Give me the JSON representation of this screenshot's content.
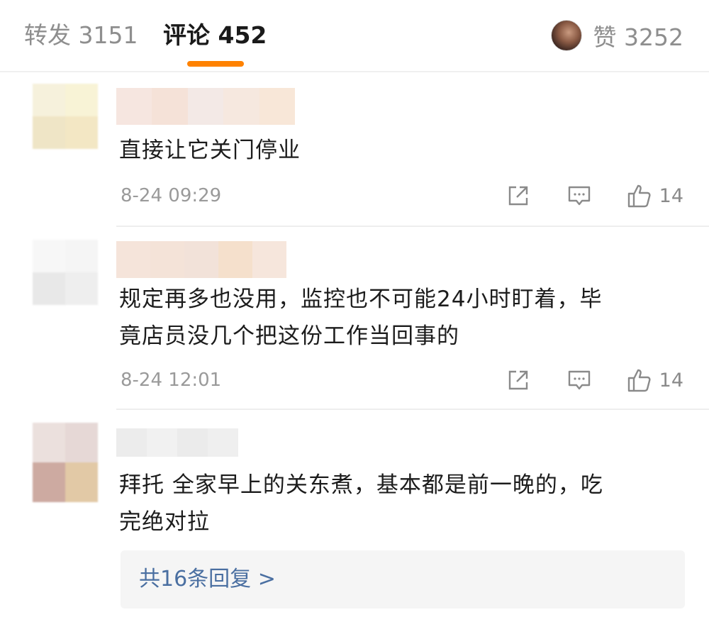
{
  "tabs": {
    "repost": "转发 3151",
    "comment": "评论 452",
    "likes": "赞 3252"
  },
  "colors": {
    "accent": "#ff8200",
    "link": "#4a6fa1"
  },
  "icons": {
    "share": "share-icon",
    "reply": "comment-icon",
    "like": "thumbs-up-icon"
  },
  "comments": [
    {
      "text_lines": [
        "直接让它关门停业"
      ],
      "time": "8-24 09:29",
      "likes": "14"
    },
    {
      "text_lines": [
        "规定再多也没用，监控也不可能24小时盯着，毕",
        "竟店员没几个把这份工作当回事的"
      ],
      "time": "8-24 12:01",
      "likes": "14"
    },
    {
      "text_lines": [
        "拜托 全家早上的关东煮，基本都是前一晚的，吃",
        "完绝对拉"
      ],
      "replies_link": "共16条回复 >"
    }
  ]
}
